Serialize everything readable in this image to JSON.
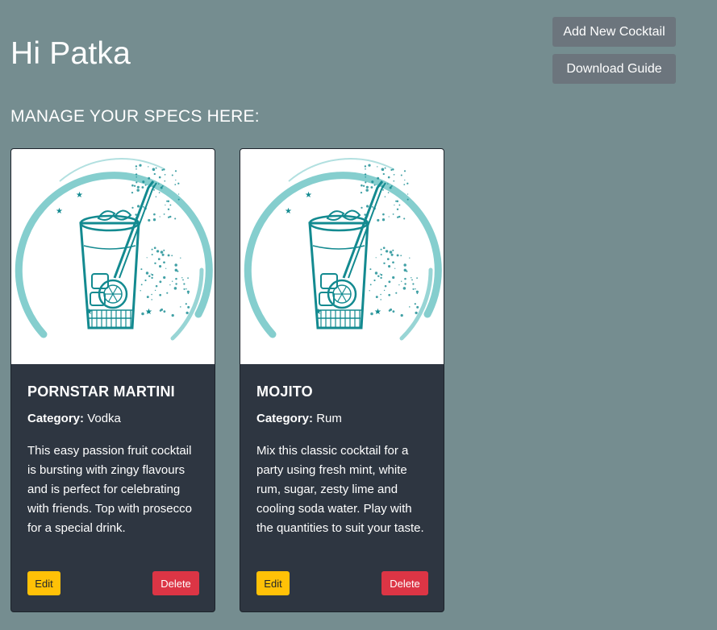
{
  "header": {
    "greeting": "Hi Patka",
    "add_button_label": "Add New Cocktail",
    "guide_button_label": "Download Guide"
  },
  "section": {
    "heading": "MANAGE YOUR SPECS HERE:"
  },
  "colors": {
    "page_background": "#758d90",
    "card_background": "#2e3641",
    "secondary_button": "#6c757d",
    "edit_button": "#ffc107",
    "delete_button": "#dc3545",
    "illustration_teal": "#138a90",
    "illustration_ring": "#7ecbcb"
  },
  "cocktails": [
    {
      "image_icon": "cocktail-glass-illustration",
      "name": "PORNSTAR MARTINI",
      "category_label": "Category:",
      "category": "Vodka",
      "description": "This easy passion fruit cocktail is bursting with zingy flavours and is perfect for celebrating with friends. Top with prosecco for a special drink.",
      "edit_label": "Edit",
      "delete_label": "Delete"
    },
    {
      "image_icon": "cocktail-glass-illustration",
      "name": "MOJITO",
      "category_label": "Category:",
      "category": "Rum",
      "description": "Mix this classic cocktail for a party using fresh mint, white rum, sugar, zesty lime and cooling soda water. Play with the quantities to suit your taste.",
      "edit_label": "Edit",
      "delete_label": "Delete"
    }
  ]
}
